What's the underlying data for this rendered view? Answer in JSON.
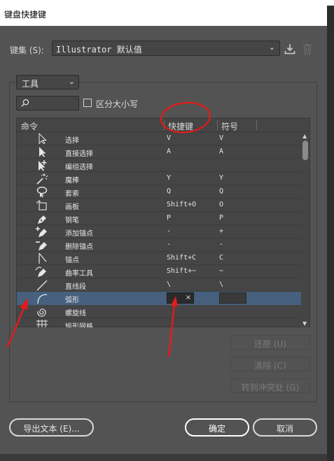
{
  "window": {
    "title": "键盘快捷键"
  },
  "keyset": {
    "label": "键集 (S):",
    "value": "Illustrator 默认值",
    "save_icon": "save-keyset-icon",
    "delete_icon": "trash-icon"
  },
  "tool_select": {
    "value": "工具"
  },
  "search": {
    "placeholder": "",
    "icon": "search-icon"
  },
  "match_case": {
    "label": "区分大小写",
    "checked": false
  },
  "table": {
    "headers": {
      "command": "命令",
      "shortcut": "快捷键",
      "symbol": "符号"
    },
    "rows": [
      {
        "icon": "selection-tool-icon",
        "name": "选择",
        "shortcut": "V",
        "symbol": "V"
      },
      {
        "icon": "direct-selection-tool-icon",
        "name": "直接选择",
        "shortcut": "A",
        "symbol": "A"
      },
      {
        "icon": "group-selection-tool-icon",
        "name": "编组选择",
        "shortcut": "",
        "symbol": ""
      },
      {
        "icon": "magic-wand-tool-icon",
        "name": "魔棒",
        "shortcut": "Y",
        "symbol": "Y"
      },
      {
        "icon": "lasso-tool-icon",
        "name": "套索",
        "shortcut": "Q",
        "symbol": "Q"
      },
      {
        "icon": "artboard-tool-icon",
        "name": "画板",
        "shortcut": "Shift+O",
        "symbol": "O"
      },
      {
        "icon": "pen-tool-icon",
        "name": "钢笔",
        "shortcut": "P",
        "symbol": "P"
      },
      {
        "icon": "add-anchor-point-icon",
        "name": "添加锚点",
        "shortcut": "-",
        "symbol": "+"
      },
      {
        "icon": "delete-anchor-point-icon",
        "name": "删除锚点",
        "shortcut": "-",
        "symbol": "-"
      },
      {
        "icon": "anchor-point-tool-icon",
        "name": "锚点",
        "shortcut": "Shift+C",
        "symbol": "C"
      },
      {
        "icon": "curvature-tool-icon",
        "name": "曲率工具",
        "shortcut": "Shift+~",
        "symbol": "~"
      },
      {
        "icon": "line-segment-tool-icon",
        "name": "直线段",
        "shortcut": "\\",
        "symbol": "\\"
      },
      {
        "icon": "arc-tool-icon",
        "name": "弧形",
        "shortcut": "",
        "symbol": "",
        "editing": true,
        "clear_glyph": "×"
      },
      {
        "icon": "spiral-tool-icon",
        "name": "螺旋线",
        "shortcut": "",
        "symbol": ""
      },
      {
        "icon": "rectangular-grid-tool-icon",
        "name": "矩形网格",
        "shortcut": "",
        "symbol": ""
      }
    ]
  },
  "side_buttons": {
    "undo": "还原 (U)",
    "clear": "清除 (C)",
    "goto_conflict": "转到冲突处 (G)"
  },
  "footer": {
    "export": "导出文本 (E)...",
    "ok": "确定",
    "cancel": "取消"
  },
  "colors": {
    "background": "#535353",
    "table_bg": "#454545",
    "selected_row": "#46607e",
    "annotation": "#e31b1b"
  }
}
